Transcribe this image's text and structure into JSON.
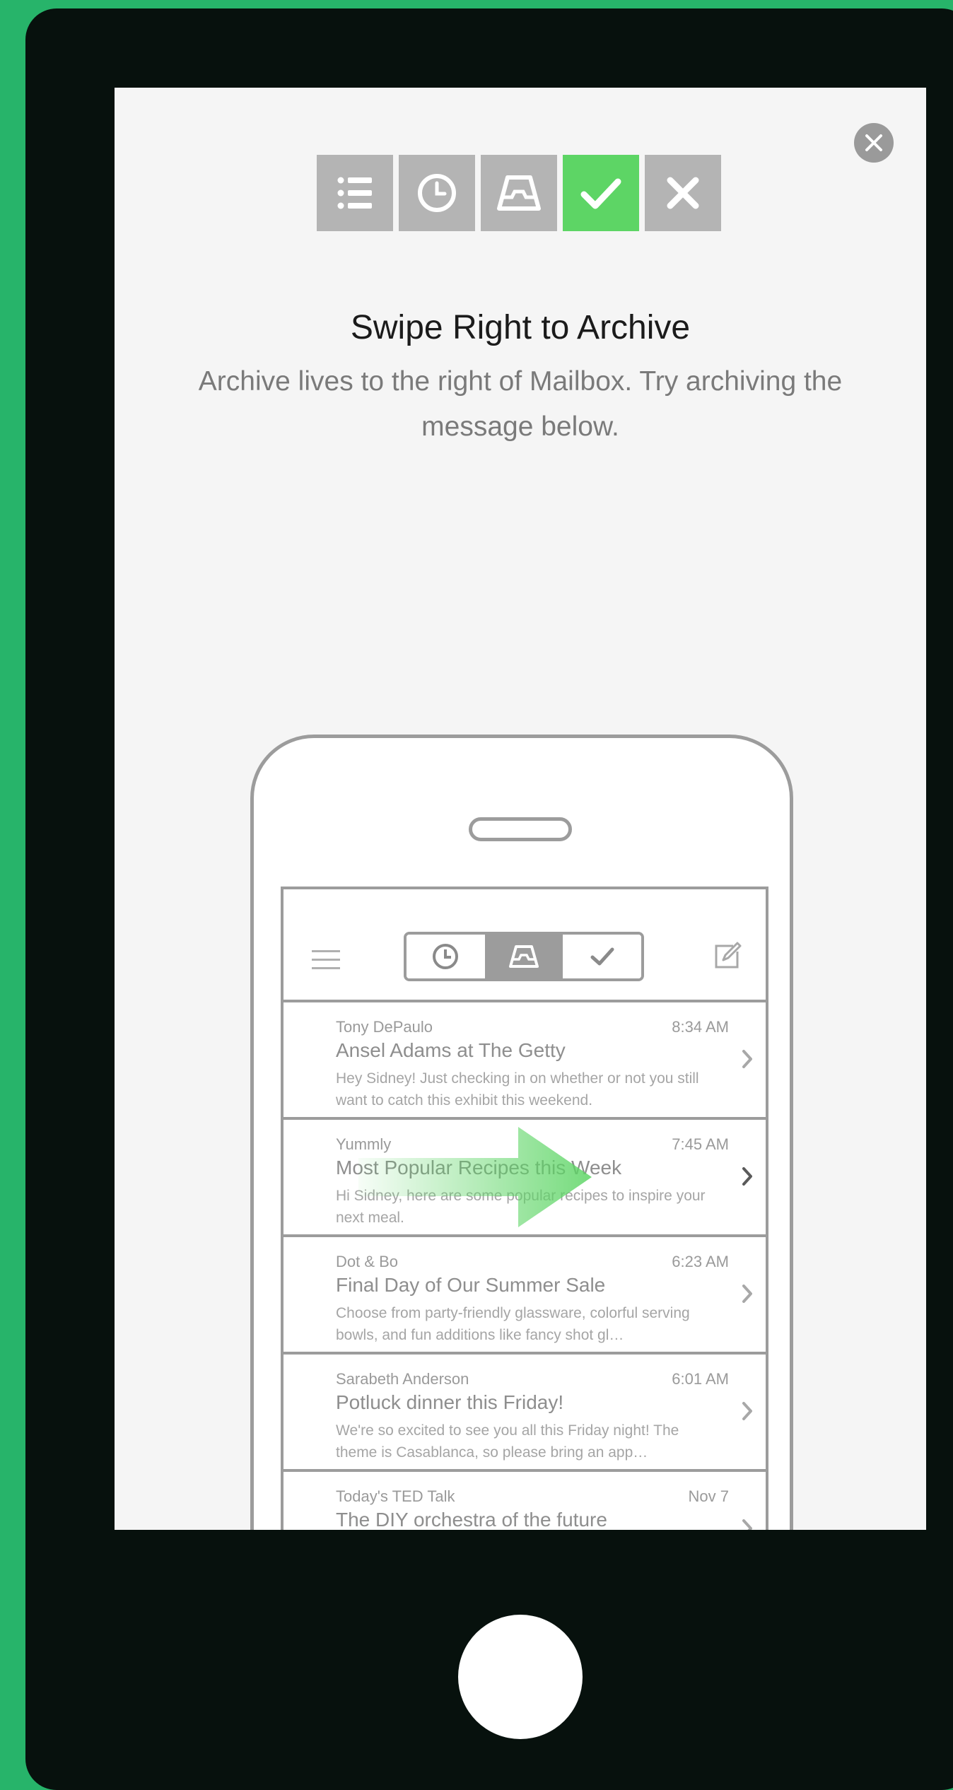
{
  "onboarding": {
    "title": "Swipe Right to Archive",
    "subtitle": "Archive lives to the right of Mailbox. Try archiving the message below.",
    "action_icons": [
      "list-icon",
      "clock-icon",
      "inbox-tray-icon",
      "check-icon",
      "x-icon"
    ],
    "active_action": "check-icon",
    "close_icon": "close-icon"
  },
  "inner_app": {
    "nav_icons": [
      "hamburger-icon",
      "clock-icon",
      "inbox-tray-icon",
      "check-icon",
      "compose-icon"
    ],
    "active_segment": "inbox-tray-icon",
    "messages": [
      {
        "from": "Tony DePaulo",
        "time": "8:34 AM",
        "subject": "Ansel Adams at The Getty",
        "preview": "Hey Sidney! Just checking in on whether or not you still want to catch this exhibit this weekend."
      },
      {
        "from": "Yummly",
        "time": "7:45 AM",
        "subject": "Most Popular Recipes this Week",
        "preview": "Hi Sidney, here are some popular recipes to inspire your next meal."
      },
      {
        "from": "Dot & Bo",
        "time": "6:23 AM",
        "subject": "Final Day of Our Summer Sale",
        "preview": "Choose from party-friendly glassware, colorful serving bowls, and fun additions like fancy shot gl…"
      },
      {
        "from": "Sarabeth Anderson",
        "time": "6:01 AM",
        "subject": "Potluck dinner this Friday!",
        "preview": "We're so excited to see you all this Friday night! The theme is Casablanca, so please bring an app…"
      },
      {
        "from": "Today's TED Talk",
        "time": "Nov 7",
        "subject": "The DIY orchestra of the future",
        "preview": ""
      }
    ]
  },
  "colors": {
    "background": "#27b46a",
    "device": "#07110d",
    "accent_green": "#5dd565",
    "action_gray": "#b4b4b4"
  }
}
